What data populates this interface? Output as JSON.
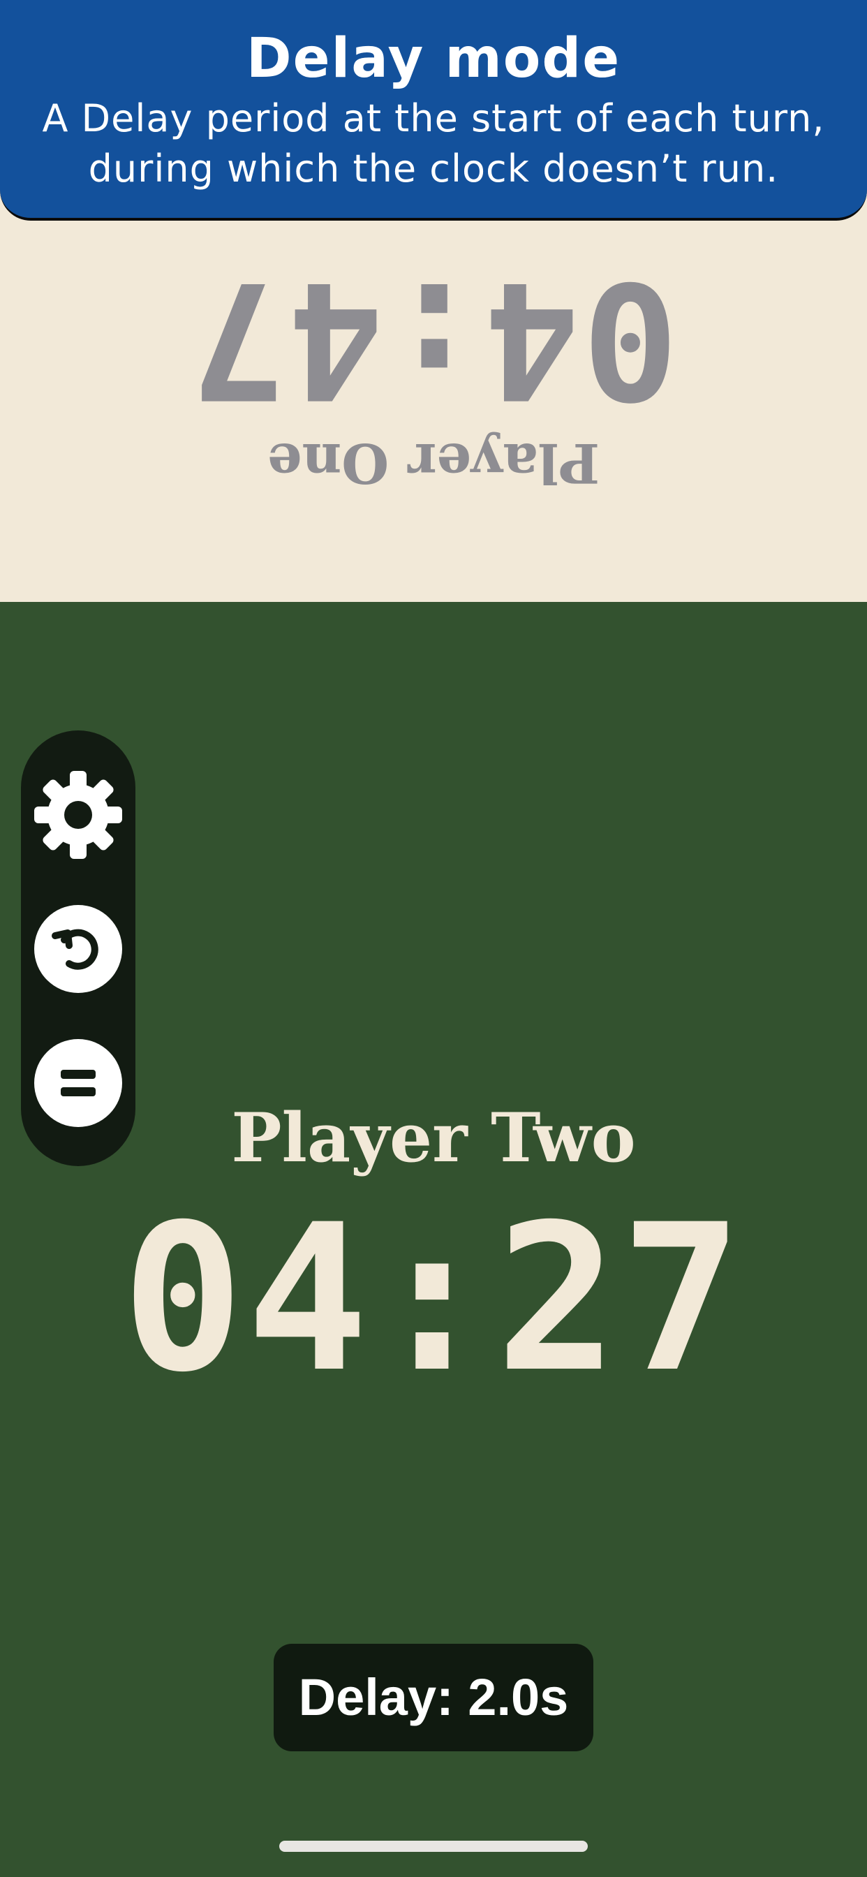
{
  "banner": {
    "title": "Delay mode",
    "description": "A Delay period at the start of each turn, during which the clock doesn’t run."
  },
  "player_one": {
    "name": "Player One",
    "time": "04:47",
    "orientation": "rotated-180"
  },
  "player_two": {
    "name": "Player Two",
    "time": "04:27"
  },
  "toolbar": {
    "items": [
      {
        "icon": "gear-icon"
      },
      {
        "icon": "reset-icon"
      },
      {
        "icon": "pause-icon"
      }
    ]
  },
  "delay_indicator": {
    "label": "Delay: 2.0s"
  },
  "colors": {
    "banner": "#13519c",
    "inactive_panel": "#f2e9d8",
    "active_panel": "#33522f",
    "inactive_text": "#8e8d92",
    "active_text": "#f2e9d8",
    "toolbar": "#121b12"
  }
}
